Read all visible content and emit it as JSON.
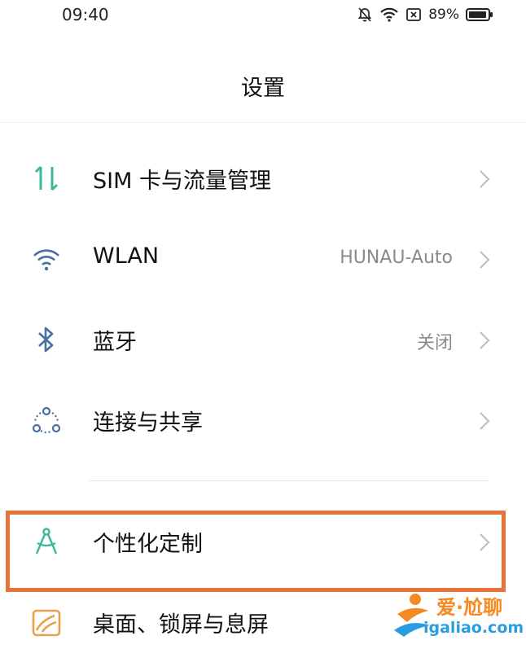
{
  "status_bar": {
    "time": "09:40",
    "battery_percent": "89%",
    "icons": [
      "bell-muted-icon",
      "wifi-icon",
      "sim-off-icon",
      "battery-icon"
    ]
  },
  "header": {
    "title": "设置"
  },
  "settings": [
    {
      "id": "sim",
      "label": "SIM 卡与流量管理",
      "value": "",
      "icon": "data-transfer-icon",
      "icon_color": "#3bb89a"
    },
    {
      "id": "wlan",
      "label": "WLAN",
      "value": "HUNAU-Auto",
      "icon": "wifi-icon",
      "icon_color": "#4a6fa0"
    },
    {
      "id": "bluetooth",
      "label": "蓝牙",
      "value": "关闭",
      "icon": "bluetooth-icon",
      "icon_color": "#4a6fa0"
    },
    {
      "id": "connect",
      "label": "连接与共享",
      "value": "",
      "icon": "connection-share-icon",
      "icon_color": "#4a6fa0"
    },
    {
      "id": "personalize",
      "label": "个性化定制",
      "value": "",
      "icon": "compass-icon",
      "icon_color": "#3bb89a"
    },
    {
      "id": "desktop",
      "label": "桌面、锁屏与息屏",
      "value": "",
      "icon": "wallpaper-icon",
      "icon_color": "#e8a04a"
    }
  ],
  "highlight": {
    "target": "personalize",
    "color": "#e8743a"
  },
  "watermark": {
    "main": "爱·尬聊",
    "sub": "igaliao.com"
  }
}
